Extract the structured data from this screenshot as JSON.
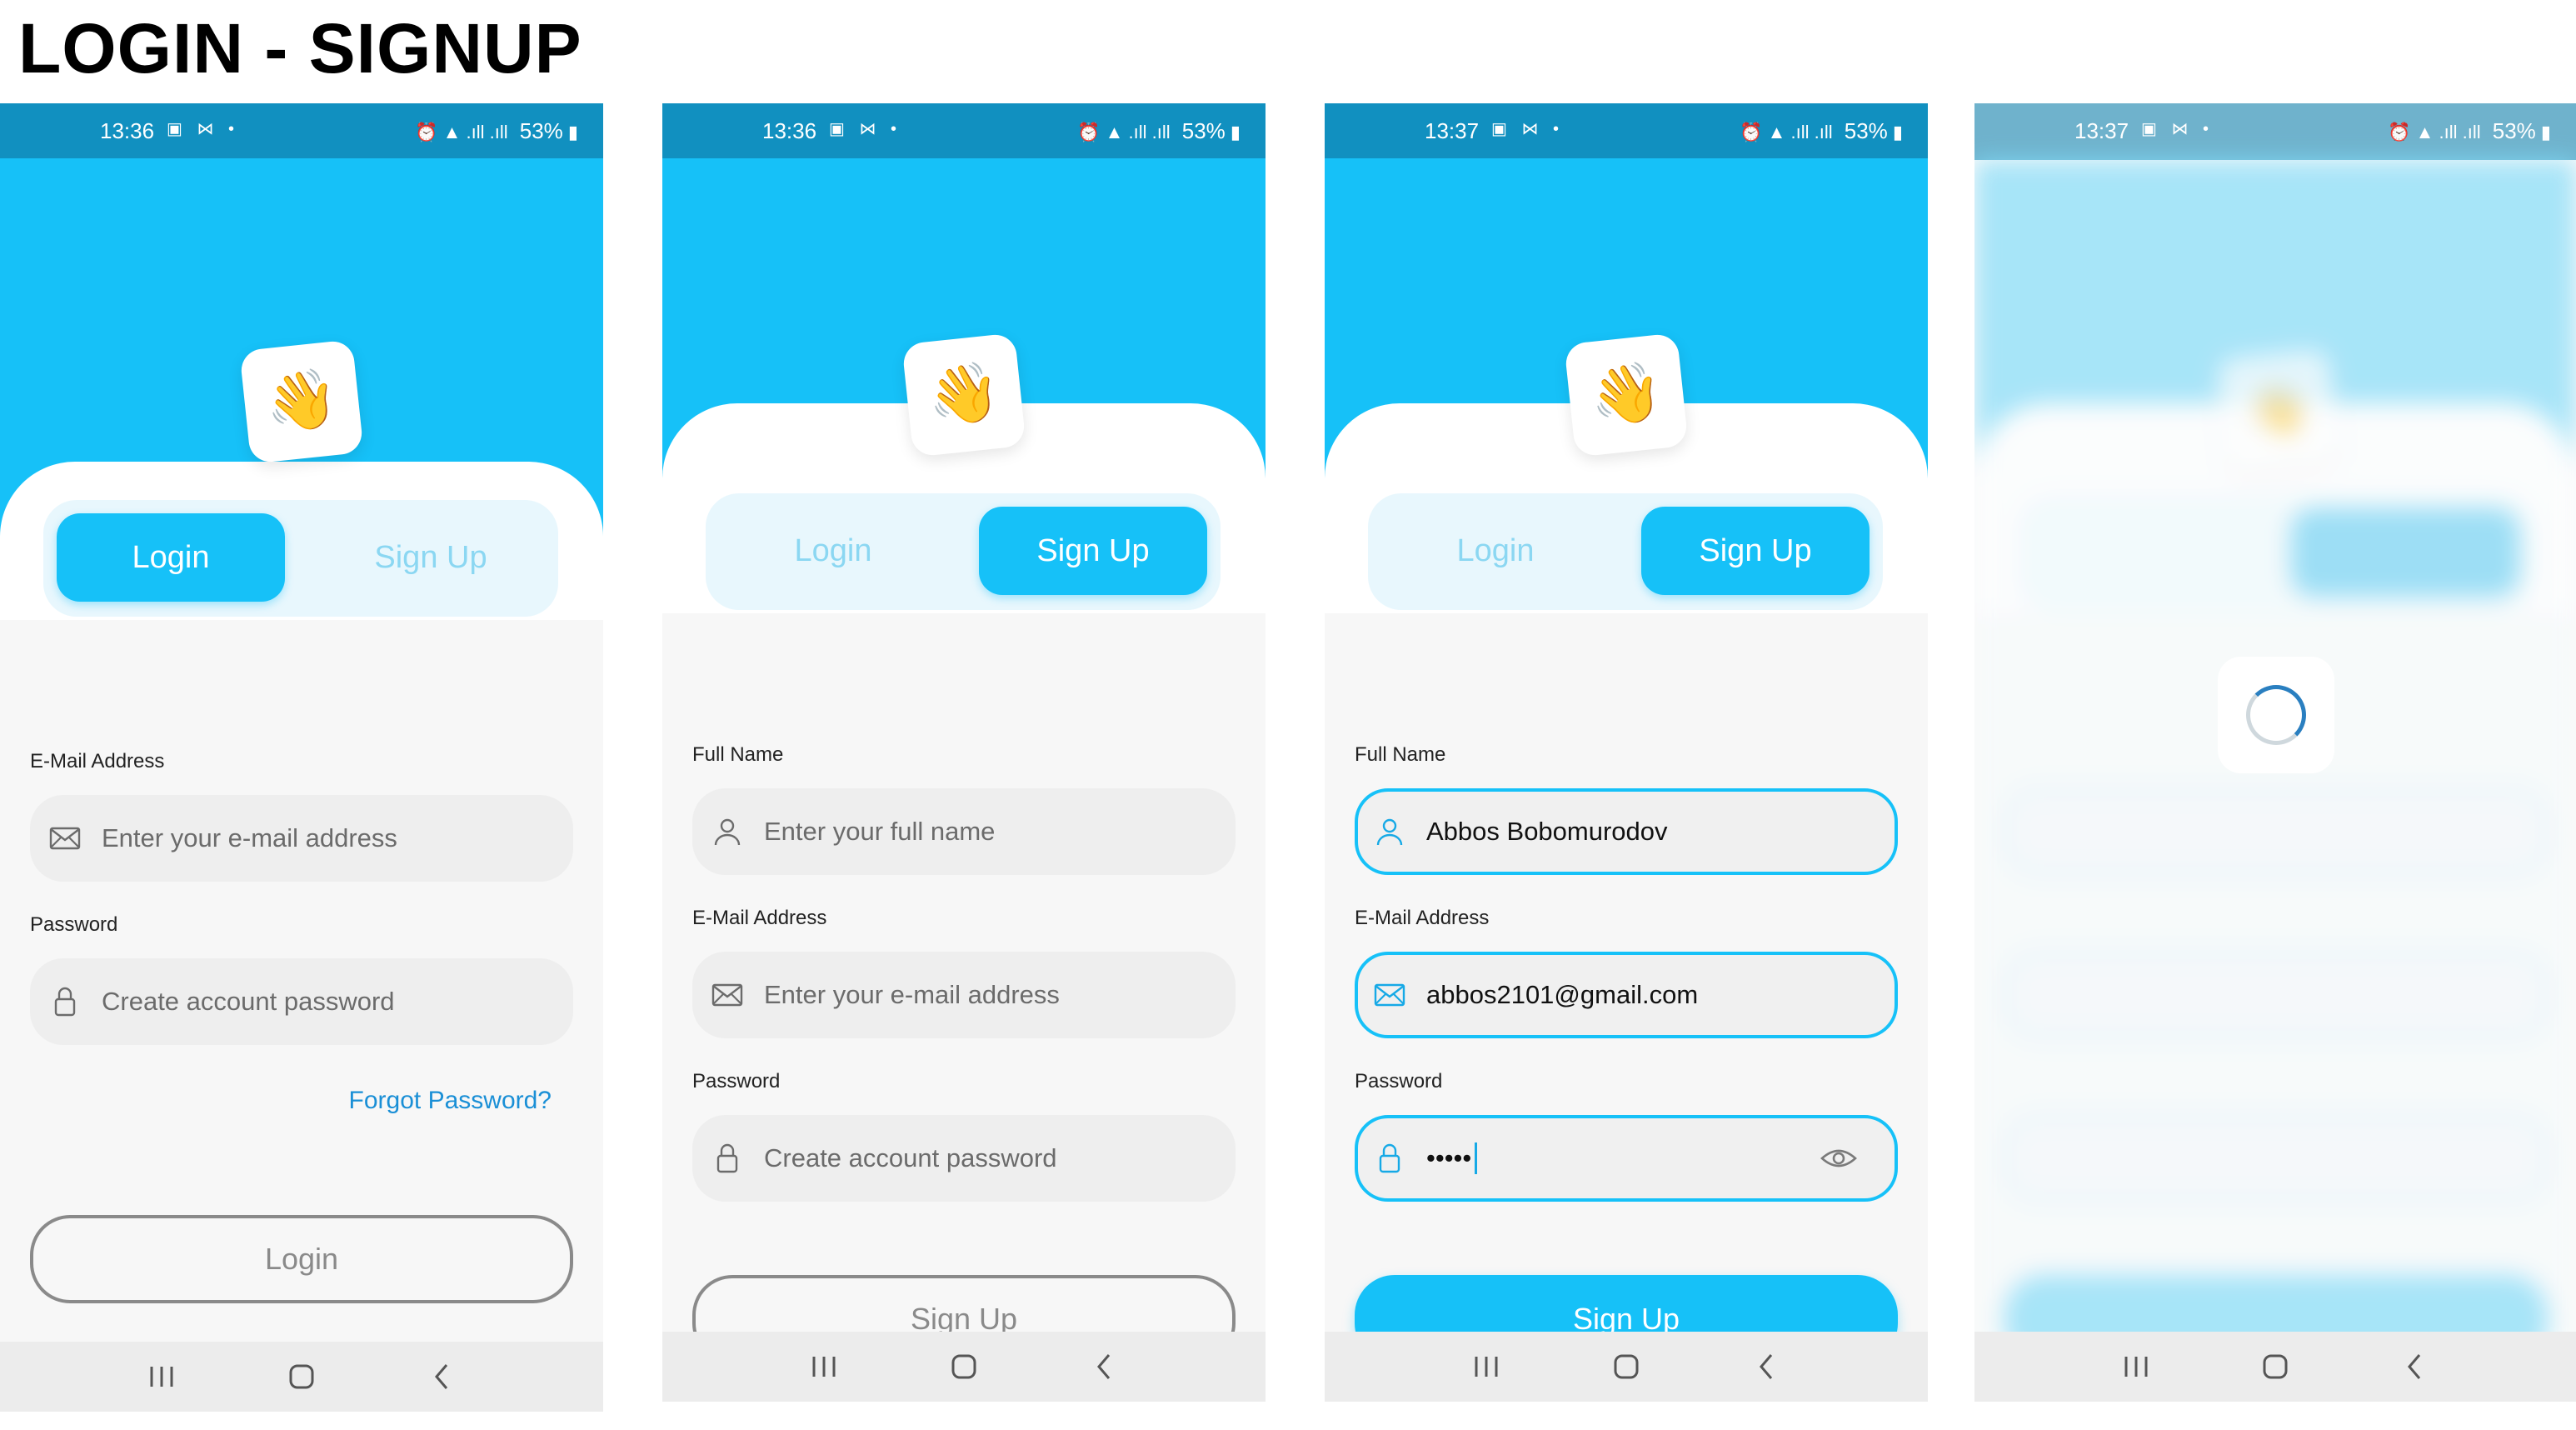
{
  "title": "LOGIN - SIGNUP",
  "colors": {
    "accent": "#16c1f8",
    "status_bar": "#1190c0",
    "link": "#1a8fd6"
  },
  "screens": [
    {
      "status": {
        "time": "13:36",
        "battery": "53%"
      },
      "tabs": {
        "login": "Login",
        "signup": "Sign Up",
        "active": "login"
      },
      "fields": [
        {
          "label": "E-Mail Address",
          "icon": "mail-icon",
          "placeholder": "Enter your e-mail address",
          "value": ""
        },
        {
          "label": "Password",
          "icon": "lock-icon",
          "placeholder": "Create account password",
          "value": ""
        }
      ],
      "forgot": "Forgot Password?",
      "submit": "Login"
    },
    {
      "status": {
        "time": "13:36",
        "battery": "53%"
      },
      "tabs": {
        "login": "Login",
        "signup": "Sign Up",
        "active": "signup"
      },
      "fields": [
        {
          "label": "Full Name",
          "icon": "user-icon",
          "placeholder": "Enter your full name",
          "value": ""
        },
        {
          "label": "E-Mail Address",
          "icon": "mail-icon",
          "placeholder": "Enter your e-mail address",
          "value": ""
        },
        {
          "label": "Password",
          "icon": "lock-icon",
          "placeholder": "Create account password",
          "value": ""
        }
      ],
      "submit": "Sign Up"
    },
    {
      "status": {
        "time": "13:37",
        "battery": "53%"
      },
      "tabs": {
        "login": "Login",
        "signup": "Sign Up",
        "active": "signup"
      },
      "fields": [
        {
          "label": "Full Name",
          "icon": "user-icon",
          "value": "Abbos Bobomurodov"
        },
        {
          "label": "E-Mail Address",
          "icon": "mail-icon",
          "value": "abbos2101@gmail.com"
        },
        {
          "label": "Password",
          "icon": "lock-icon",
          "value": "•••••"
        }
      ],
      "submit": "Sign Up"
    },
    {
      "status": {
        "time": "13:37",
        "battery": "53%"
      },
      "loading": true
    }
  ]
}
